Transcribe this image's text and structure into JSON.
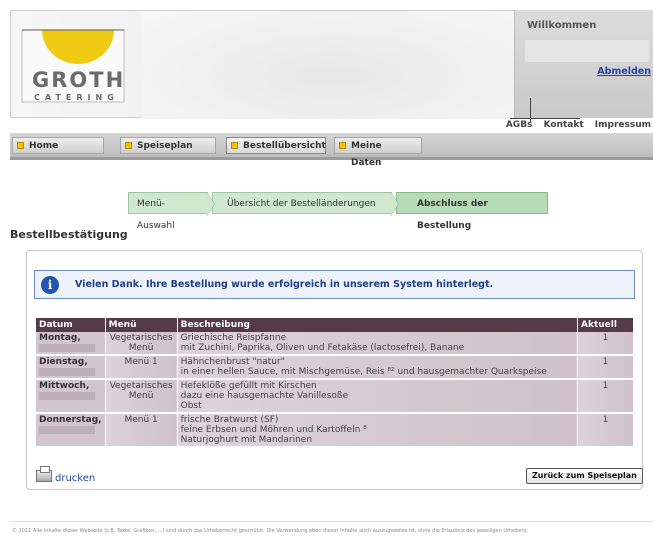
{
  "header": {
    "logo_text": "GROTH",
    "logo_sub": "CATERING",
    "welcome": "Willkommen",
    "logout": "Abmelden"
  },
  "toplinks": [
    "AGBs",
    "Kontakt",
    "Impressum"
  ],
  "nav": {
    "tabs": [
      {
        "label": "Home"
      },
      {
        "label": "Speiseplan"
      },
      {
        "label": "Bestellübersicht"
      },
      {
        "label": "Meine Daten"
      }
    ]
  },
  "steps": [
    {
      "label": "Menü-Auswahl"
    },
    {
      "label": "Übersicht der Bestelländerungen"
    },
    {
      "label": "Abschluss der Bestellung"
    }
  ],
  "page": {
    "title": "Bestellbestätigung",
    "info": "Vielen Dank. Ihre Bestellung wurde erfolgreich in unserem System hinterlegt."
  },
  "table": {
    "headers": [
      "Datum",
      "Menü",
      "Beschreibung",
      "Aktuell"
    ],
    "rows": [
      {
        "day": "Montag,",
        "menu": [
          "Vegetarisches",
          "Menü"
        ],
        "desc": [
          "Griechische Reispfanne",
          "mit Zuchini, Paprika, Oliven und Fetakäse (lactosefrei), Banane"
        ],
        "current": "1"
      },
      {
        "day": "Dienstag,",
        "menu": [
          "Menü 1"
        ],
        "desc": [
          "Hähnchenbrust \"natur\"",
          "in einer hellen Sauce, mit Mischgemüse, Reis ⁸² und hausgemachter Quarkspeise"
        ],
        "current": "1"
      },
      {
        "day": "Mittwoch,",
        "menu": [
          "Vegetarisches",
          "Menü"
        ],
        "desc": [
          "Hefeklöße gefüllt mit Kirschen",
          "dazu eine hausgemachte Vanillesoße",
          "Obst"
        ],
        "current": "1"
      },
      {
        "day": "Donnerstag,",
        "menu": [
          "Menü 1"
        ],
        "desc": [
          "frische Bratwurst (SF)",
          "feine Erbsen und Möhren und Kartoffeln ⁸",
          "Naturjoghurt mit Mandarinen"
        ],
        "current": "1"
      }
    ]
  },
  "actions": {
    "print": "drucken",
    "back": "Zurück zum Speiseplan"
  },
  "footer": "© 2011 Alle Inhalte dieser Webseite (z.B. Texte, Grafiken, ...) sind durch das Urheberrecht geschützt. Die Verwendung eben dieser Inhalte auch auszugsweise ist, ohne die Erlaubnis des jeweiligen Urhebers,"
}
